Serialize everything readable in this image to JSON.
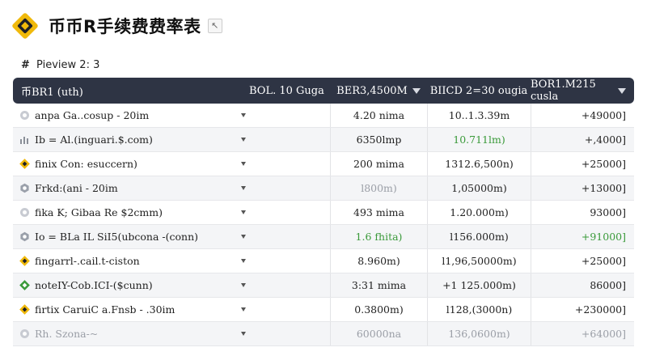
{
  "header": {
    "title": "币币R手续费费率表",
    "title_icon": "cursor-icon"
  },
  "preview": {
    "label": "Pieview",
    "count": "2: 3"
  },
  "colors": {
    "header_bg": "#2e3444",
    "accent": "#f0b90b",
    "positive": "#3a9a3a"
  },
  "table": {
    "columns": [
      "币BR1 (uth)",
      "BOL. 10 Guga",
      "BER3,4500M",
      "BIICD 2=30 ougia",
      "BOR1.M215 cusla"
    ],
    "rows": [
      {
        "name": "anpa Ga..cosup - 20im",
        "icon": "grey",
        "c3": "4.20 nima",
        "c4": "10..1.3.39m",
        "c5": "+49000]",
        "c3_color": "",
        "c4_color": "",
        "c5_color": ""
      },
      {
        "name": "Ib = Al.(inguari.$.com)",
        "icon": "chart",
        "c3": "6350lmp",
        "c4": "10.711lm)",
        "c5": "+,4000]",
        "c3_color": "",
        "c4_color": "green",
        "c5_color": ""
      },
      {
        "name": "finix Con: esuccern)",
        "icon": "gold",
        "c3": "200 mima",
        "c4": "1312.6,500n)",
        "c5": "+25000]",
        "c3_color": "",
        "c4_color": "",
        "c5_color": ""
      },
      {
        "name": "Frkd:(ani - 20im",
        "icon": "hex",
        "c3": "l800m)",
        "c4": "1,05000m)",
        "c5": "+13000]",
        "c3_color": "grey",
        "c4_color": "",
        "c5_color": ""
      },
      {
        "name": "fika K; Gibaa Re $2cmm)",
        "icon": "grey",
        "c3": "493 mima",
        "c4": "1.20.000m)",
        "c5": "93000]",
        "c3_color": "",
        "c4_color": "",
        "c5_color": ""
      },
      {
        "name": "Io = BLa IL SiI5(ubcona -(conn)",
        "icon": "hex",
        "c3": "1.6 fhita)",
        "c4": "l156.000m)",
        "c5": "+91000]",
        "c3_color": "green",
        "c4_color": "",
        "c5_color": "green"
      },
      {
        "name": "fingarrl-.cail.t-ciston",
        "icon": "gold",
        "c3": "8.960m)",
        "c4": "l1,96,50000m)",
        "c5": "+25000]",
        "c3_color": "",
        "c4_color": "",
        "c5_color": ""
      },
      {
        "name": "noteIY-Cob.ICI-($cunn)",
        "icon": "green",
        "c3": "3:31 mima",
        "c4": "+1 125.000m)",
        "c5": "86000]",
        "c3_color": "",
        "c4_color": "",
        "c5_color": ""
      },
      {
        "name": "firtix CaruiC a.Fnsb - .30im",
        "icon": "gold",
        "c3": "0.3800m)",
        "c4": "l128,(3000n)",
        "c5": "+230000]",
        "c3_color": "",
        "c4_color": "",
        "c5_color": ""
      },
      {
        "name": "Rh. Szona-~",
        "icon": "grey",
        "c3": "60000na",
        "c4": "136,0600m)",
        "c5": "+64000]",
        "c3_color": "",
        "c4_color": "",
        "c5_color": ""
      }
    ]
  }
}
